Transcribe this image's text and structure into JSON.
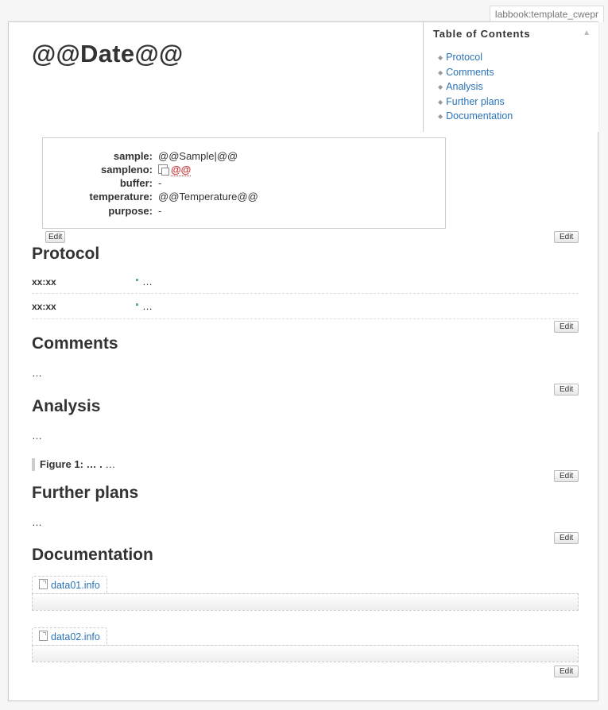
{
  "page_id": "labbook:template_cwepr",
  "title": "@@Date@@",
  "toc": {
    "heading": "Table of Contents",
    "toggle": "▲",
    "items": [
      "Protocol",
      "Comments",
      "Analysis",
      "Further plans",
      "Documentation"
    ]
  },
  "datatable": {
    "rows": [
      {
        "label": "sample:",
        "value": "@@Sample|@@"
      },
      {
        "label": "sampleno:",
        "value": "@@"
      },
      {
        "label": "buffer:",
        "value": "-"
      },
      {
        "label": "temperature:",
        "value": "@@Temperature@@"
      },
      {
        "label": "purpose:",
        "value": "-"
      }
    ]
  },
  "edit_label": "Edit",
  "sections": {
    "protocol": {
      "heading": "Protocol",
      "rows": [
        {
          "time": "xx:xx",
          "text": "…"
        },
        {
          "time": "xx:xx",
          "text": "…"
        }
      ]
    },
    "comments": {
      "heading": "Comments",
      "text": "…"
    },
    "analysis": {
      "heading": "Analysis",
      "text": "…",
      "figure_label": "Figure 1: … .",
      "figure_text": " …"
    },
    "further": {
      "heading": "Further plans",
      "text": "…"
    },
    "documentation": {
      "heading": "Documentation",
      "files": [
        "data01.info",
        "data02.info"
      ]
    }
  }
}
